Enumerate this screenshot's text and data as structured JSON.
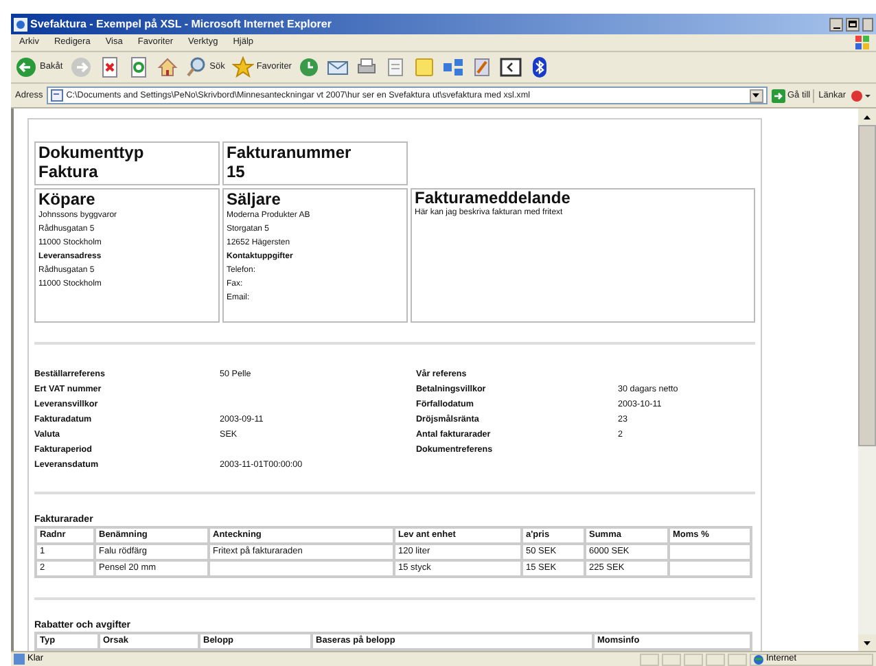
{
  "window": {
    "title": "Svefaktura - Exempel på XSL - Microsoft Internet Explorer"
  },
  "menu": [
    "Arkiv",
    "Redigera",
    "Visa",
    "Favoriter",
    "Verktyg",
    "Hjälp"
  ],
  "toolbar": [
    {
      "kind": "back",
      "label": "Bakåt"
    },
    {
      "kind": "forward"
    },
    {
      "kind": "stop"
    },
    {
      "kind": "refresh"
    },
    {
      "kind": "home"
    },
    {
      "kind": "search",
      "label": "Sök"
    },
    {
      "kind": "favorites",
      "label": "Favoriter"
    },
    {
      "kind": "history"
    },
    {
      "kind": "mail"
    },
    {
      "kind": "print"
    },
    {
      "kind": "edit"
    },
    {
      "kind": "note"
    },
    {
      "kind": "share"
    },
    {
      "kind": "tool"
    },
    {
      "kind": "screen"
    },
    {
      "kind": "bluetooth"
    }
  ],
  "address": {
    "label": "Adress",
    "value": "C:\\Documents and Settings\\PeNo\\Skrivbord\\Minnesanteckningar vt 2007\\hur ser en Svefaktura ut\\svefaktura med xsl.xml",
    "go": "Gå till",
    "links": "Länkar"
  },
  "invoice": {
    "header": [
      {
        "label": "Dokumenttyp",
        "value": "Faktura"
      },
      {
        "label": "Fakturanummer",
        "value": "15"
      }
    ],
    "parties": [
      {
        "title": "Köpare",
        "lines": [
          "Johnssons byggvaror",
          "Rådhusgatan 5",
          "11000 Stockholm"
        ],
        "subtitle": "Leveransadress",
        "sublines": [
          "Rådhusgatan 5",
          "11000 Stockholm"
        ]
      },
      {
        "title": "Säljare",
        "lines": [
          "Moderna Produkter AB",
          "Storgatan 5",
          "12652 Hägersten"
        ],
        "subtitle": "Kontaktuppgifter",
        "sublines": [
          "Telefon:",
          "Fax:",
          "Email:"
        ]
      }
    ],
    "message": {
      "title": "Fakturameddelande",
      "text": "Här kan jag beskriva fakturan med fritext"
    },
    "references_left": [
      {
        "label": "Beställarreferens",
        "value": "50 Pelle"
      },
      {
        "label": "Ert VAT nummer"
      },
      {
        "label": "Leveransvillkor"
      },
      {
        "label": "Fakturadatum",
        "value": "2003-09-11"
      },
      {
        "label": "Valuta",
        "value": "SEK"
      },
      {
        "label": "Fakturaperiod"
      },
      {
        "label": "Leveransdatum",
        "value": "2003-11-01T00:00:00"
      }
    ],
    "references_right": [
      {
        "label": "Vår referens"
      },
      {
        "label": "Betalningsvillkor",
        "value": "30 dagars netto"
      },
      {
        "label": "Förfallodatum",
        "value": "2003-10-11"
      },
      {
        "label": "Dröjsmålsränta",
        "value": "23"
      },
      {
        "label": "Antal fakturarader",
        "value": "2"
      },
      {
        "label": "Dokumentreferens"
      }
    ],
    "lines": {
      "title": "Fakturarader",
      "columns": [
        "Radnr",
        "Benämning",
        "Anteckning",
        "Lev ant enhet",
        "a'pris",
        "Summa",
        "Moms %"
      ],
      "rows": [
        [
          "1",
          "Falu rödfärg",
          "Fritext på fakturaraden",
          "120 liter",
          "50 SEK",
          "6000 SEK"
        ],
        [
          "2",
          "Pensel 20 mm",
          null,
          "15 styck",
          "15 SEK",
          "225 SEK"
        ]
      ]
    },
    "charges": {
      "title": "Rabatter och avgifter",
      "columns": [
        "Typ",
        "Orsak",
        "Belopp",
        "Baseras på belopp",
        "Momsinfo"
      ]
    }
  },
  "status_bar": {
    "text": "Klar",
    "zone": "Internet"
  }
}
